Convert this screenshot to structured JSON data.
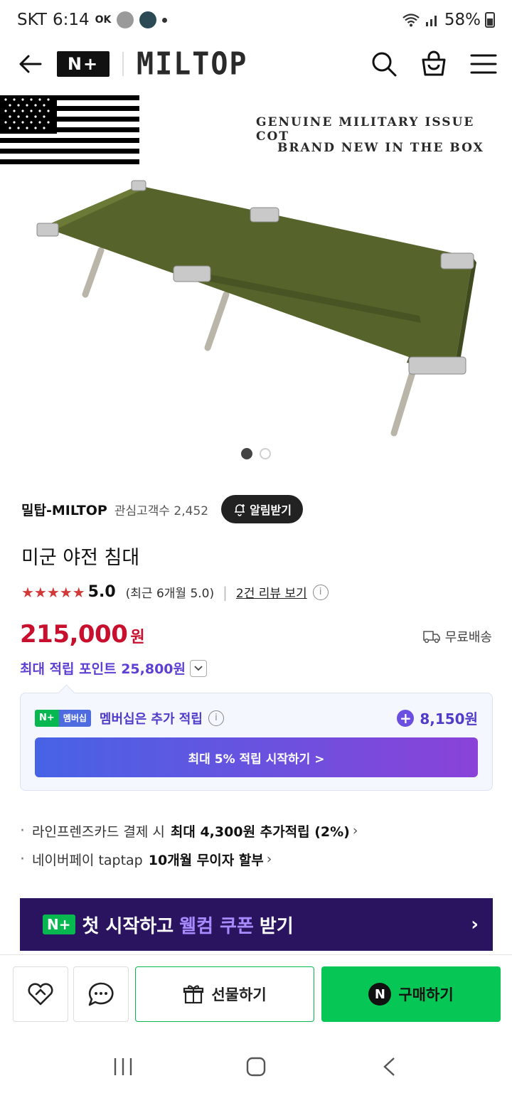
{
  "status_bar": {
    "carrier": "SKT",
    "time": "6:14",
    "battery": "58%",
    "ok_label": "OK"
  },
  "header": {
    "badge": "N+",
    "brand": "MILTOP"
  },
  "hero": {
    "caption_line1": "GENUINE MILITARY ISSUE COT",
    "caption_line2": "BRAND NEW IN THE BOX",
    "page_count": 2,
    "current_page": 1
  },
  "store": {
    "name": "밀탑-MILTOP",
    "fans": "관심고객수 2,452",
    "follow_label": "알림받기"
  },
  "product": {
    "title": "미군 야전 침대",
    "stars": "★★★★★",
    "score": "5.0",
    "recent": "(최근 6개월 5.0)",
    "review_link": "2건 리뷰 보기",
    "price": "215,000",
    "currency": "원",
    "shipping": "무료배송",
    "points": "최대 적립 포인트 25,800원"
  },
  "membership": {
    "badge_np": "N+",
    "badge_label": "멤버십",
    "text": "멤버십은 추가 적립",
    "amount": "8,150원",
    "button": "최대 5% 적립 시작하기 >"
  },
  "benefits": [
    {
      "text": "라인프렌즈카드 결제 시",
      "bold": "최대 4,300원 추가적립 (2%)"
    },
    {
      "text": "네이버페이 taptap",
      "bold": "10개월 무이자 할부"
    }
  ],
  "welcome": {
    "badge": "N+",
    "pre": "첫 시작하고",
    "highlight": "웰컴 쿠폰",
    "post": "받기"
  },
  "actions": {
    "gift": "선물하기",
    "buy": "구매하기",
    "buy_icon": "N"
  }
}
